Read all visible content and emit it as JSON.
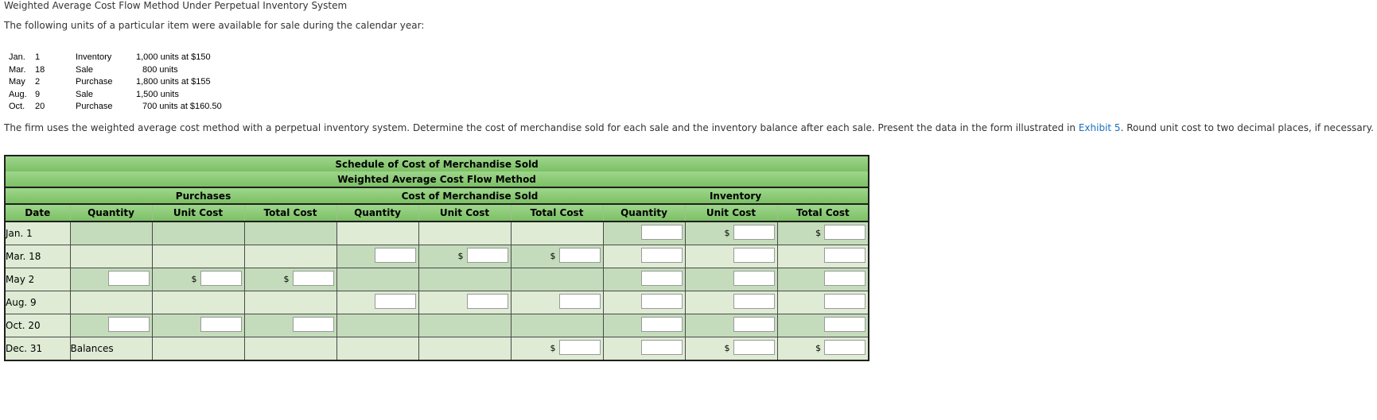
{
  "title": "Weighted Average Cost Flow Method Under Perpetual Inventory System",
  "intro": "The following units of a particular item were available for sale during the calendar year:",
  "units": [
    {
      "month": "Jan.",
      "day": "1",
      "type": "Inventory",
      "detail": "1,000 units at $150"
    },
    {
      "month": "Mar.",
      "day": "18",
      "type": "Sale",
      "detail": "800 units"
    },
    {
      "month": "May",
      "day": "2",
      "type": "Purchase",
      "detail": "1,800 units at $155"
    },
    {
      "month": "Aug.",
      "day": "9",
      "type": "Sale",
      "detail": "1,500 units"
    },
    {
      "month": "Oct.",
      "day": "20",
      "type": "Purchase",
      "detail": "700 units at $160.50"
    }
  ],
  "instructions": {
    "before": "The firm uses the weighted average cost method with a perpetual inventory system. Determine the cost of merchandise sold for each sale and the inventory balance after each sale. Present the data in the form illustrated in ",
    "link": "Exhibit 5",
    "after": ". Round unit cost to two decimal places, if necessary."
  },
  "schedule": {
    "title1": "Schedule of Cost of Merchandise Sold",
    "title2": "Weighted Average Cost Flow Method",
    "group_purchases": "Purchases",
    "group_cms": "Cost of Merchandise Sold",
    "group_inventory": "Inventory",
    "columns": [
      "Date",
      "Quantity",
      "Unit Cost",
      "Total Cost",
      "Quantity",
      "Unit Cost",
      "Total Cost",
      "Quantity",
      "Unit Cost",
      "Total Cost"
    ],
    "dollar_sign": "$",
    "balances_label": "Balances",
    "rows": [
      {
        "date": "Jan. 1"
      },
      {
        "date": "Mar. 18"
      },
      {
        "date": "May 2"
      },
      {
        "date": "Aug. 9"
      },
      {
        "date": "Oct. 20"
      },
      {
        "date": "Dec. 31"
      }
    ]
  },
  "colors": {
    "header_green": "#8ccb75",
    "cell_light": "#dfebd4",
    "cell_dark": "#c4dcbb",
    "link": "#1a6fbf"
  }
}
